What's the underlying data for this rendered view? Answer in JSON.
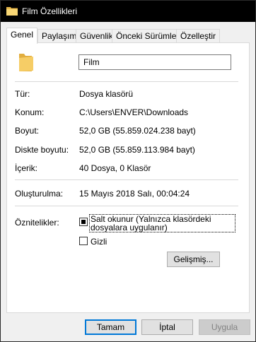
{
  "window": {
    "title": "Film Özellikleri",
    "icon": "folder-icon"
  },
  "tabs": [
    {
      "label": "Genel",
      "active": true
    },
    {
      "label": "Paylaşım",
      "active": false
    },
    {
      "label": "Güvenlik",
      "active": false
    },
    {
      "label": "Önceki Sürümler",
      "active": false
    },
    {
      "label": "Özelleştir",
      "active": false
    }
  ],
  "general": {
    "folder_name": "Film",
    "type_label": "Tür:",
    "type_value": "Dosya klasörü",
    "location_label": "Konum:",
    "location_value": "C:\\Users\\ENVER\\Downloads",
    "size_label": "Boyut:",
    "size_value": "52,0 GB (55.859.024.238 bayt)",
    "disk_size_label": "Diskte boyutu:",
    "disk_size_value": "52,0 GB (55.859.113.984 bayt)",
    "contains_label": "İçerik:",
    "contains_value": "40 Dosya, 0 Klasör",
    "created_label": "Oluşturulma:",
    "created_value": "15 Mayıs 2018 Salı, 00:04:24",
    "attributes_label": "Öznitelikler:",
    "readonly_label": "Salt okunur (Yalnızca klasördeki dosyalara uygulanır)",
    "readonly_state": "indeterminate",
    "hidden_label": "Gizli",
    "hidden_checked": false,
    "advanced_label": "Gelişmiş..."
  },
  "buttons": {
    "ok": "Tamam",
    "cancel": "İptal",
    "apply": "Uygula"
  }
}
